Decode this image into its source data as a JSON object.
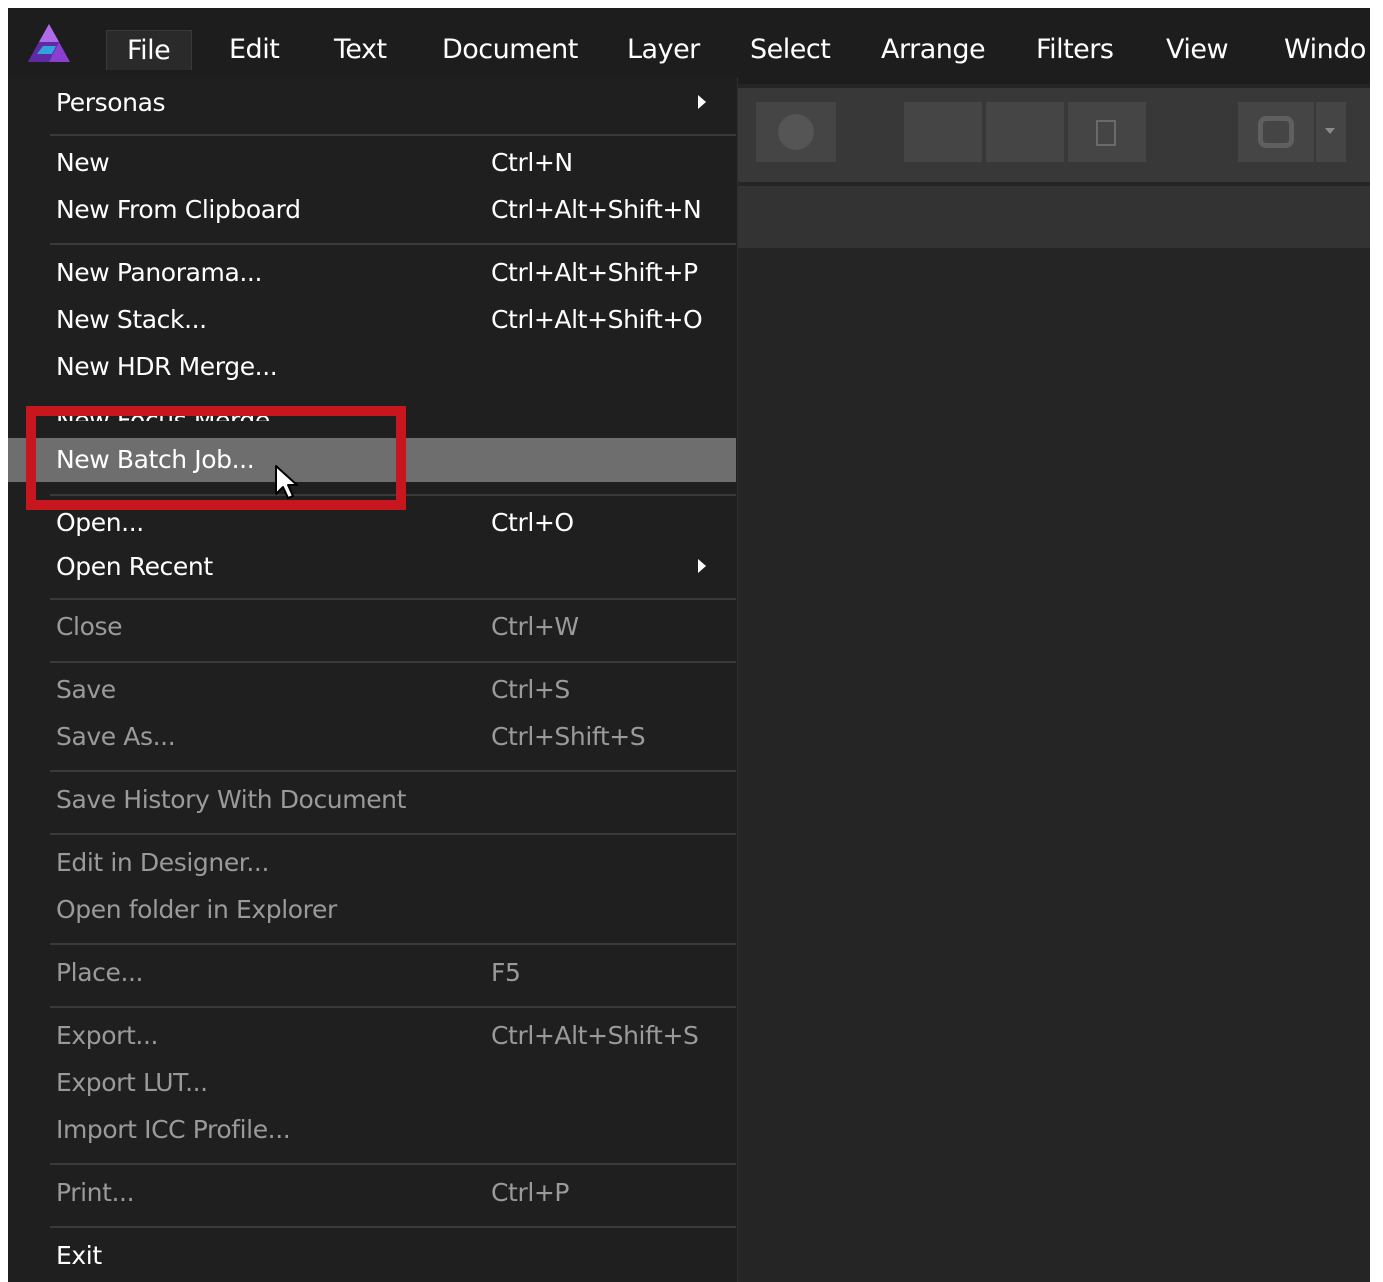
{
  "menubar": {
    "items": [
      {
        "label": "File",
        "active": true
      },
      {
        "label": "Edit"
      },
      {
        "label": "Text"
      },
      {
        "label": "Document"
      },
      {
        "label": "Layer"
      },
      {
        "label": "Select"
      },
      {
        "label": "Arrange"
      },
      {
        "label": "Filters"
      },
      {
        "label": "View"
      },
      {
        "label": "Windo"
      }
    ]
  },
  "file_menu": {
    "personas": {
      "label": "Personas",
      "submenu": true
    },
    "new": {
      "label": "New",
      "shortcut": "Ctrl+N"
    },
    "new_from_clipboard": {
      "label": "New From Clipboard",
      "shortcut": "Ctrl+Alt+Shift+N"
    },
    "new_panorama": {
      "label": "New Panorama...",
      "shortcut": "Ctrl+Alt+Shift+P"
    },
    "new_stack": {
      "label": "New Stack...",
      "shortcut": "Ctrl+Alt+Shift+O"
    },
    "new_hdr_merge": {
      "label": "New HDR Merge..."
    },
    "new_focus_merge": {
      "label": "New Focus Merge..."
    },
    "new_batch_job": {
      "label": "New Batch Job...",
      "highlighted": true
    },
    "open": {
      "label": "Open...",
      "shortcut": "Ctrl+O"
    },
    "open_recent": {
      "label": "Open Recent",
      "submenu": true
    },
    "close": {
      "label": "Close",
      "shortcut": "Ctrl+W",
      "disabled": true
    },
    "save": {
      "label": "Save",
      "shortcut": "Ctrl+S",
      "disabled": true
    },
    "save_as": {
      "label": "Save As...",
      "shortcut": "Ctrl+Shift+S",
      "disabled": true
    },
    "save_history": {
      "label": "Save History With Document",
      "disabled": true
    },
    "edit_in_designer": {
      "label": "Edit in Designer...",
      "disabled": true
    },
    "open_folder": {
      "label": "Open folder in Explorer",
      "disabled": true
    },
    "place": {
      "label": "Place...",
      "shortcut": "F5",
      "disabled": true
    },
    "export": {
      "label": "Export...",
      "shortcut": "Ctrl+Alt+Shift+S",
      "disabled": true
    },
    "export_lut": {
      "label": "Export LUT...",
      "disabled": true
    },
    "import_icc": {
      "label": "Import ICC Profile...",
      "disabled": true
    },
    "print": {
      "label": "Print...",
      "shortcut": "Ctrl+P",
      "disabled": true
    },
    "exit": {
      "label": "Exit"
    }
  },
  "icons": {
    "app_logo": "affinity-photo-logo-icon",
    "cursor": "mouse-pointer-icon",
    "submenu_arrow": "chevron-right-icon"
  },
  "colors": {
    "menu_bg": "#1f1f1f",
    "highlight_row": "#6e6e6e",
    "callout_red": "#c8161f",
    "disabled_text": "#9a9a9a",
    "logo_purple": "#7b3fc4"
  }
}
